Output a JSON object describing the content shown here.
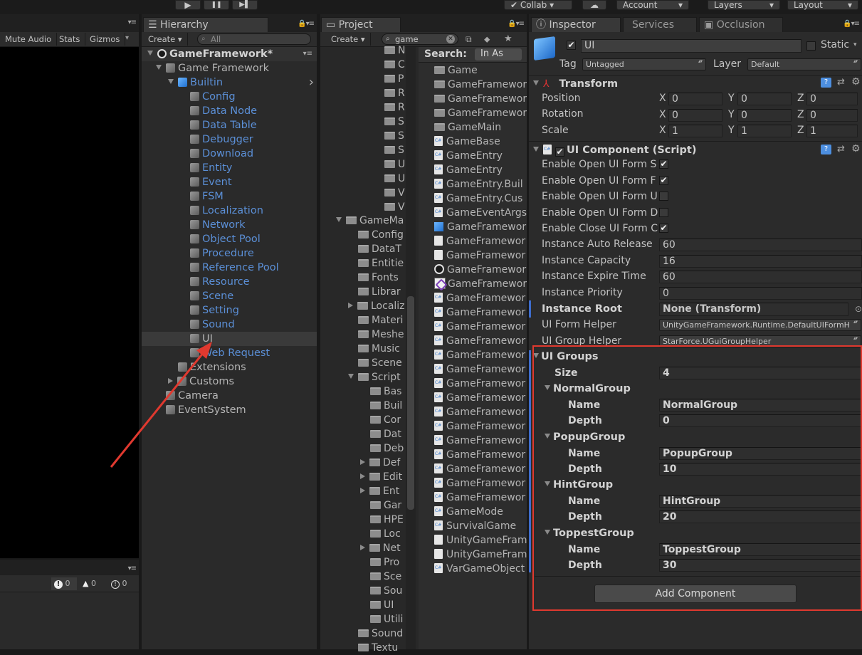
{
  "toolbar": {
    "play": "▶",
    "pause": "❚❚",
    "step": "▶▌",
    "collab": "Collab",
    "account": "Account",
    "layers": "Layers",
    "layout": "Layout"
  },
  "game": {
    "mute_audio": "Mute Audio",
    "stats": "Stats",
    "gizmos": "Gizmos"
  },
  "console": {
    "errors": "0",
    "warnings": "0",
    "logs": "0"
  },
  "hierarchy": {
    "tab": "Hierarchy",
    "create": "Create",
    "search_placeholder": "All",
    "scene": "GameFramework*",
    "items": [
      {
        "label": "Game Framework",
        "indent": 1,
        "expand": "down",
        "icon": "cube",
        "color": "normal"
      },
      {
        "label": "Builtin",
        "indent": 2,
        "expand": "down",
        "icon": "cube-blue",
        "color": "blue"
      },
      {
        "label": "Config",
        "indent": 3,
        "icon": "cube",
        "color": "blue"
      },
      {
        "label": "Data Node",
        "indent": 3,
        "icon": "cube",
        "color": "blue"
      },
      {
        "label": "Data Table",
        "indent": 3,
        "icon": "cube",
        "color": "blue"
      },
      {
        "label": "Debugger",
        "indent": 3,
        "icon": "cube",
        "color": "blue"
      },
      {
        "label": "Download",
        "indent": 3,
        "icon": "cube",
        "color": "blue"
      },
      {
        "label": "Entity",
        "indent": 3,
        "icon": "cube",
        "color": "blue"
      },
      {
        "label": "Event",
        "indent": 3,
        "icon": "cube",
        "color": "blue"
      },
      {
        "label": "FSM",
        "indent": 3,
        "icon": "cube",
        "color": "blue"
      },
      {
        "label": "Localization",
        "indent": 3,
        "icon": "cube",
        "color": "blue"
      },
      {
        "label": "Network",
        "indent": 3,
        "icon": "cube",
        "color": "blue"
      },
      {
        "label": "Object Pool",
        "indent": 3,
        "icon": "cube",
        "color": "blue"
      },
      {
        "label": "Procedure",
        "indent": 3,
        "icon": "cube",
        "color": "blue"
      },
      {
        "label": "Reference Pool",
        "indent": 3,
        "icon": "cube",
        "color": "blue"
      },
      {
        "label": "Resource",
        "indent": 3,
        "icon": "cube",
        "color": "blue"
      },
      {
        "label": "Scene",
        "indent": 3,
        "icon": "cube",
        "color": "blue"
      },
      {
        "label": "Setting",
        "indent": 3,
        "icon": "cube",
        "color": "blue"
      },
      {
        "label": "Sound",
        "indent": 3,
        "icon": "cube",
        "color": "blue"
      },
      {
        "label": "UI",
        "indent": 3,
        "icon": "cube",
        "color": "normal",
        "selected": true
      },
      {
        "label": "Web Request",
        "indent": 3,
        "icon": "cube",
        "color": "blue"
      },
      {
        "label": "Extensions",
        "indent": 2,
        "icon": "cube",
        "color": "normal"
      },
      {
        "label": "Customs",
        "indent": 2,
        "expand": "right",
        "icon": "cube",
        "color": "normal"
      },
      {
        "label": "Camera",
        "indent": 1,
        "icon": "cube",
        "color": "normal"
      },
      {
        "label": "EventSystem",
        "indent": 1,
        "icon": "cube",
        "color": "normal"
      }
    ]
  },
  "project": {
    "tab": "Project",
    "create": "Create",
    "search_value": "game",
    "search_label": "Search:",
    "search_scope": "In As",
    "tree_top": [
      "N",
      "C",
      "P",
      "R",
      "R",
      "S",
      "S",
      "S",
      "U",
      "U",
      "V",
      "V"
    ],
    "tree": [
      {
        "label": "GameMa",
        "level": 0,
        "expand": "down"
      },
      {
        "label": "Config",
        "level": 1
      },
      {
        "label": "DataT",
        "level": 1
      },
      {
        "label": "Entitie",
        "level": 1
      },
      {
        "label": "Fonts",
        "level": 1
      },
      {
        "label": "Librar",
        "level": 1
      },
      {
        "label": "Localiz",
        "level": 1,
        "expand": "right"
      },
      {
        "label": "Materi",
        "level": 1
      },
      {
        "label": "Meshe",
        "level": 1
      },
      {
        "label": "Music",
        "level": 1
      },
      {
        "label": "Scene",
        "level": 1
      },
      {
        "label": "Script",
        "level": 1,
        "expand": "down"
      },
      {
        "label": "Bas",
        "level": 2
      },
      {
        "label": "Buil",
        "level": 2
      },
      {
        "label": "Cor",
        "level": 2
      },
      {
        "label": "Dat",
        "level": 2
      },
      {
        "label": "Deb",
        "level": 2
      },
      {
        "label": "Def",
        "level": 2,
        "expand": "right"
      },
      {
        "label": "Edit",
        "level": 2,
        "expand": "right"
      },
      {
        "label": "Ent",
        "level": 2,
        "expand": "right"
      },
      {
        "label": "Gar",
        "level": 2
      },
      {
        "label": "HPE",
        "level": 2
      },
      {
        "label": "Loc",
        "level": 2
      },
      {
        "label": "Net",
        "level": 2,
        "expand": "right"
      },
      {
        "label": "Pro",
        "level": 2
      },
      {
        "label": "Sce",
        "level": 2
      },
      {
        "label": "Sou",
        "level": 2
      },
      {
        "label": "UI",
        "level": 2
      },
      {
        "label": "Utili",
        "level": 2
      },
      {
        "label": "Sound",
        "level": 1
      },
      {
        "label": "Textu",
        "level": 1
      }
    ],
    "results": [
      {
        "label": "Game",
        "icon": "folder"
      },
      {
        "label": "GameFramewor",
        "icon": "folder"
      },
      {
        "label": "GameFramewor",
        "icon": "folder"
      },
      {
        "label": "GameFramewor",
        "icon": "folder"
      },
      {
        "label": "GameMain",
        "icon": "folder"
      },
      {
        "label": "GameBase",
        "icon": "script"
      },
      {
        "label": "GameEntry",
        "icon": "script"
      },
      {
        "label": "GameEntry",
        "icon": "script"
      },
      {
        "label": "GameEntry.Buil",
        "icon": "script"
      },
      {
        "label": "GameEntry.Cus",
        "icon": "script"
      },
      {
        "label": "GameEventArgs",
        "icon": "script"
      },
      {
        "label": "GameFramewor",
        "icon": "prefab"
      },
      {
        "label": "GameFramewor",
        "icon": "file"
      },
      {
        "label": "GameFramewor",
        "icon": "file"
      },
      {
        "label": "GameFramewor",
        "icon": "unity"
      },
      {
        "label": "GameFramewor",
        "icon": "vs"
      },
      {
        "label": "GameFramewor",
        "icon": "script"
      },
      {
        "label": "GameFramewor",
        "icon": "script"
      },
      {
        "label": "GameFramewor",
        "icon": "script"
      },
      {
        "label": "GameFramewor",
        "icon": "script"
      },
      {
        "label": "GameFramewor",
        "icon": "script"
      },
      {
        "label": "GameFramewor",
        "icon": "script"
      },
      {
        "label": "GameFramewor",
        "icon": "script"
      },
      {
        "label": "GameFramewor",
        "icon": "script"
      },
      {
        "label": "GameFramewor",
        "icon": "script"
      },
      {
        "label": "GameFramewor",
        "icon": "script"
      },
      {
        "label": "GameFramewor",
        "icon": "script"
      },
      {
        "label": "GameFramewor",
        "icon": "script"
      },
      {
        "label": "GameFramewor",
        "icon": "script"
      },
      {
        "label": "GameFramewor",
        "icon": "script"
      },
      {
        "label": "GameFramewor",
        "icon": "script"
      },
      {
        "label": "GameMode",
        "icon": "script"
      },
      {
        "label": "SurvivalGame",
        "icon": "script"
      },
      {
        "label": "UnityGameFram",
        "icon": "file"
      },
      {
        "label": "UnityGameFram",
        "icon": "file"
      },
      {
        "label": "VarGameObject",
        "icon": "script"
      }
    ]
  },
  "inspector": {
    "tabs": {
      "inspector": "Inspector",
      "services": "Services",
      "occlusion": "Occlusion"
    },
    "object_name": "UI",
    "static_label": "Static",
    "tag_label": "Tag",
    "tag_value": "Untagged",
    "layer_label": "Layer",
    "layer_value": "Default",
    "transform": {
      "title": "Transform",
      "position": "Position",
      "rotation": "Rotation",
      "scale": "Scale",
      "x": "X",
      "y": "Y",
      "z": "Z",
      "pos": [
        "0",
        "0",
        "0"
      ],
      "rot": [
        "0",
        "0",
        "0"
      ],
      "scl": [
        "1",
        "1",
        "1"
      ]
    },
    "ui_component": {
      "title": "UI Component (Script)",
      "bool_props": [
        {
          "label": "Enable Open UI Form S",
          "checked": true
        },
        {
          "label": "Enable Open UI Form F",
          "checked": true
        },
        {
          "label": "Enable Open UI Form U",
          "checked": false
        },
        {
          "label": "Enable Open UI Form D",
          "checked": false
        },
        {
          "label": "Enable Close UI Form C",
          "checked": true
        }
      ],
      "num_props": [
        {
          "label": "Instance Auto Release",
          "value": "60"
        },
        {
          "label": "Instance Capacity",
          "value": "16"
        },
        {
          "label": "Instance Expire Time",
          "value": "60"
        },
        {
          "label": "Instance Priority",
          "value": "0"
        }
      ],
      "instance_root": {
        "label": "Instance Root",
        "value": "None (Transform)"
      },
      "form_helper": {
        "label": "UI Form Helper",
        "value": "UnityGameFramework.Runtime.DefaultUIFormH"
      },
      "group_helper": {
        "label": "UI Group Helper",
        "value": "StarForce.UGuiGroupHelper"
      },
      "groups_label": "UI Groups",
      "size_label": "Size",
      "size_value": "4",
      "name_label": "Name",
      "depth_label": "Depth",
      "groups": [
        {
          "title": "NormalGroup",
          "name": "NormalGroup",
          "depth": "0"
        },
        {
          "title": "PopupGroup",
          "name": "PopupGroup",
          "depth": "10"
        },
        {
          "title": "HintGroup",
          "name": "HintGroup",
          "depth": "20"
        },
        {
          "title": "ToppestGroup",
          "name": "ToppestGroup",
          "depth": "30"
        }
      ]
    },
    "add_component": "Add Component"
  },
  "colors": {
    "highlight_box": "#e0392f",
    "link_blue": "#5b8fd6",
    "arrow": "#e0392f"
  }
}
